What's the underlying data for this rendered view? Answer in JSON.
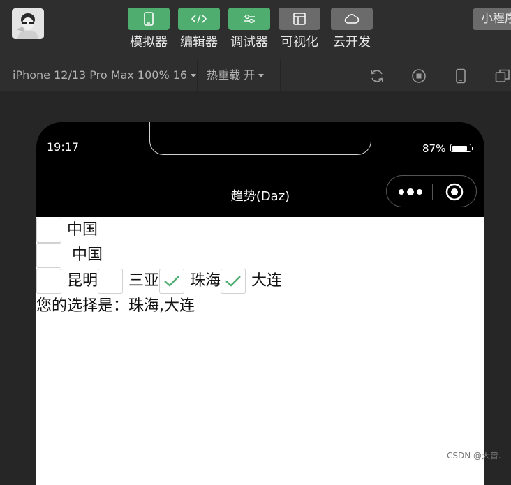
{
  "toolbar": {
    "tools": [
      {
        "label": "模拟器",
        "icon": "phone-icon",
        "style": "green"
      },
      {
        "label": "编辑器",
        "icon": "code-icon",
        "style": "green"
      },
      {
        "label": "调试器",
        "icon": "sliders-icon",
        "style": "green"
      },
      {
        "label": "可视化",
        "icon": "layout-icon",
        "style": "gray"
      },
      {
        "label": "云开发",
        "icon": "cloud-icon",
        "style": "gray"
      }
    ],
    "mini_program_label": "小程序",
    "colors": {
      "active": "#4ead6f",
      "inactive": "#6b6b6b"
    }
  },
  "subbar": {
    "device": "iPhone 12/13 Pro Max 100% 16",
    "hot_reload": "热重载 开"
  },
  "simulator": {
    "status_time": "19:17",
    "battery_percent": "87%",
    "battery_level": 0.87,
    "nav_title": "趋势(Daz)",
    "rows": [
      [
        {
          "label": "中国",
          "checked": false
        }
      ],
      [
        {
          "label": " 中国",
          "checked": false
        }
      ],
      [
        {
          "label": "昆明",
          "checked": false
        },
        {
          "label": "三亚",
          "checked": false
        },
        {
          "label": "珠海",
          "checked": true
        },
        {
          "label": "大连",
          "checked": true
        }
      ]
    ],
    "result_text": "您的选择是：珠海,大连"
  },
  "watermark": "CSDN @大曾."
}
